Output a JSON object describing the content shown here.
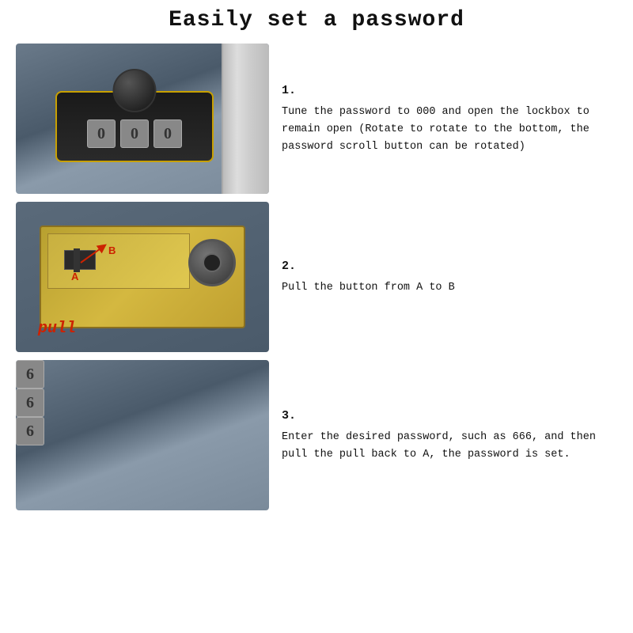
{
  "page": {
    "title": "Easily set a password",
    "steps": [
      {
        "id": "step-1",
        "number": "1.",
        "description": "Tune the password to 000 and open the lockbox to remain open (Rotate to rotate to the bottom, the password scroll button can be rotated)",
        "dial_values": [
          "0",
          "0",
          "0"
        ]
      },
      {
        "id": "step-2",
        "number": "2.",
        "description": "Pull the button from A to B",
        "label_a": "A",
        "label_b": "B",
        "pull_label": "pull"
      },
      {
        "id": "step-3",
        "number": "3.",
        "description": "Enter the desired password, such as 666, and then pull the pull back to A,  the password is set.",
        "dial_values": [
          "6",
          "6",
          "6"
        ]
      }
    ]
  }
}
